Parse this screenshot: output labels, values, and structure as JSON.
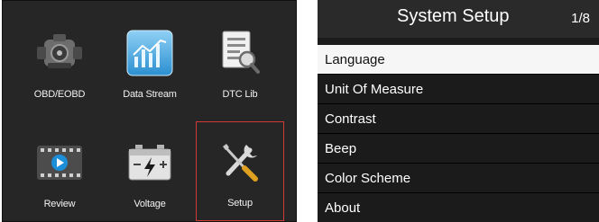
{
  "main_menu": {
    "selected": "Setup",
    "tiles": [
      {
        "label": "OBD/EOBD",
        "icon": "engine-icon"
      },
      {
        "label": "Data Stream",
        "icon": "data-stream-icon"
      },
      {
        "label": "DTC Lib",
        "icon": "dtc-library-icon"
      },
      {
        "label": "Review",
        "icon": "review-film-icon"
      },
      {
        "label": "Voltage",
        "icon": "battery-icon"
      },
      {
        "label": "Setup",
        "icon": "wrench-screwdriver-icon"
      }
    ]
  },
  "system_setup": {
    "title": "System Setup",
    "page_indicator": "1/8",
    "selected": "Language",
    "items": [
      {
        "label": "Language"
      },
      {
        "label": "Unit Of Measure"
      },
      {
        "label": "Contrast"
      },
      {
        "label": "Beep"
      },
      {
        "label": "Color Scheme"
      },
      {
        "label": "About"
      }
    ]
  },
  "colors": {
    "screen_background": "#262626",
    "selection_border": "#d23a3a",
    "selected_row": "#f6f6f6"
  }
}
